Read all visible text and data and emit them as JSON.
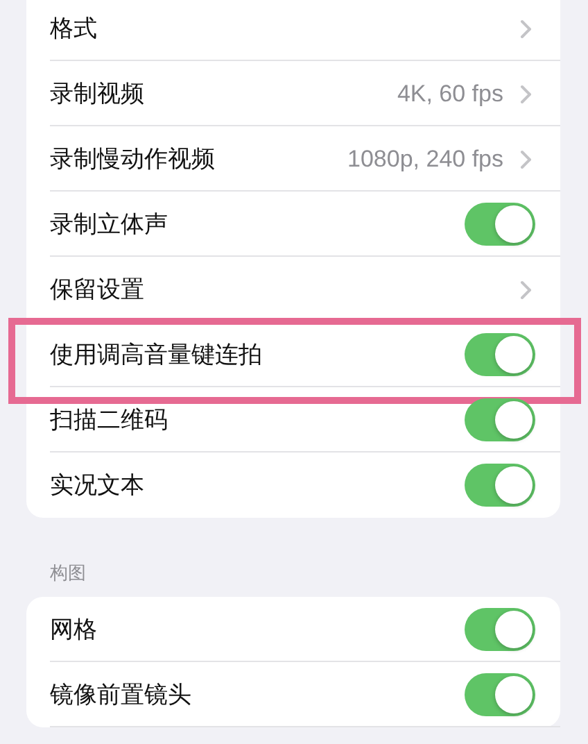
{
  "sections": [
    {
      "items": [
        {
          "kind": "link",
          "label": "格式"
        },
        {
          "kind": "link",
          "label": "录制视频",
          "value": "4K, 60 fps"
        },
        {
          "kind": "link",
          "label": "录制慢动作视频",
          "value": "1080p, 240 fps"
        },
        {
          "kind": "toggle",
          "label": "录制立体声",
          "on": true
        },
        {
          "kind": "link",
          "label": "保留设置"
        },
        {
          "kind": "toggle",
          "label": "使用调高音量键连拍",
          "on": true,
          "highlighted": true
        },
        {
          "kind": "toggle",
          "label": "扫描二维码",
          "on": true
        },
        {
          "kind": "toggle",
          "label": "实况文本",
          "on": true
        }
      ]
    },
    {
      "header": "构图",
      "items": [
        {
          "kind": "toggle",
          "label": "网格",
          "on": true
        },
        {
          "kind": "toggle",
          "label": "镜像前置镜头",
          "on": true
        }
      ]
    }
  ]
}
